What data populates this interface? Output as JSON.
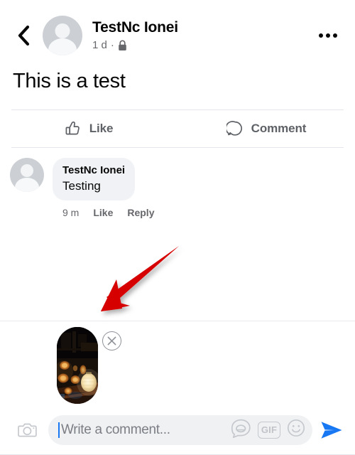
{
  "header": {
    "back_icon": "chevron-left-icon",
    "author_name": "TestNc Ionei",
    "timestamp": "1 d",
    "separator": "·",
    "privacy_icon": "lock-icon",
    "more_icon": "ellipsis-icon"
  },
  "post": {
    "text": "This is a test",
    "actions": [
      {
        "label": "Like",
        "icon": "thumbs-up-icon"
      },
      {
        "label": "Comment",
        "icon": "comment-bubble-icon"
      }
    ]
  },
  "comment": {
    "author": "TestNc Ionei",
    "text": "Testing",
    "time": "9 m",
    "like_label": "Like",
    "reply_label": "Reply"
  },
  "attachment": {
    "type": "image-thumbnail",
    "description": "night street lanterns photo",
    "remove_icon": "close-circle-icon"
  },
  "annotation": {
    "type": "arrow",
    "color": "#d60000",
    "points_to": "attachment-thumbnail"
  },
  "composer": {
    "camera_icon": "camera-icon",
    "placeholder": "Write a comment...",
    "value": "",
    "sticker_icon": "sticker-icon",
    "gif_label": "GIF",
    "emoji_icon": "emoji-smiley-icon",
    "send_icon": "send-arrow-icon"
  },
  "colors": {
    "accent_blue": "#1877f2",
    "text_primary": "#050505",
    "text_secondary": "#65676b",
    "bubble_bg": "#f0f2f5",
    "annotation_red": "#d60000"
  }
}
